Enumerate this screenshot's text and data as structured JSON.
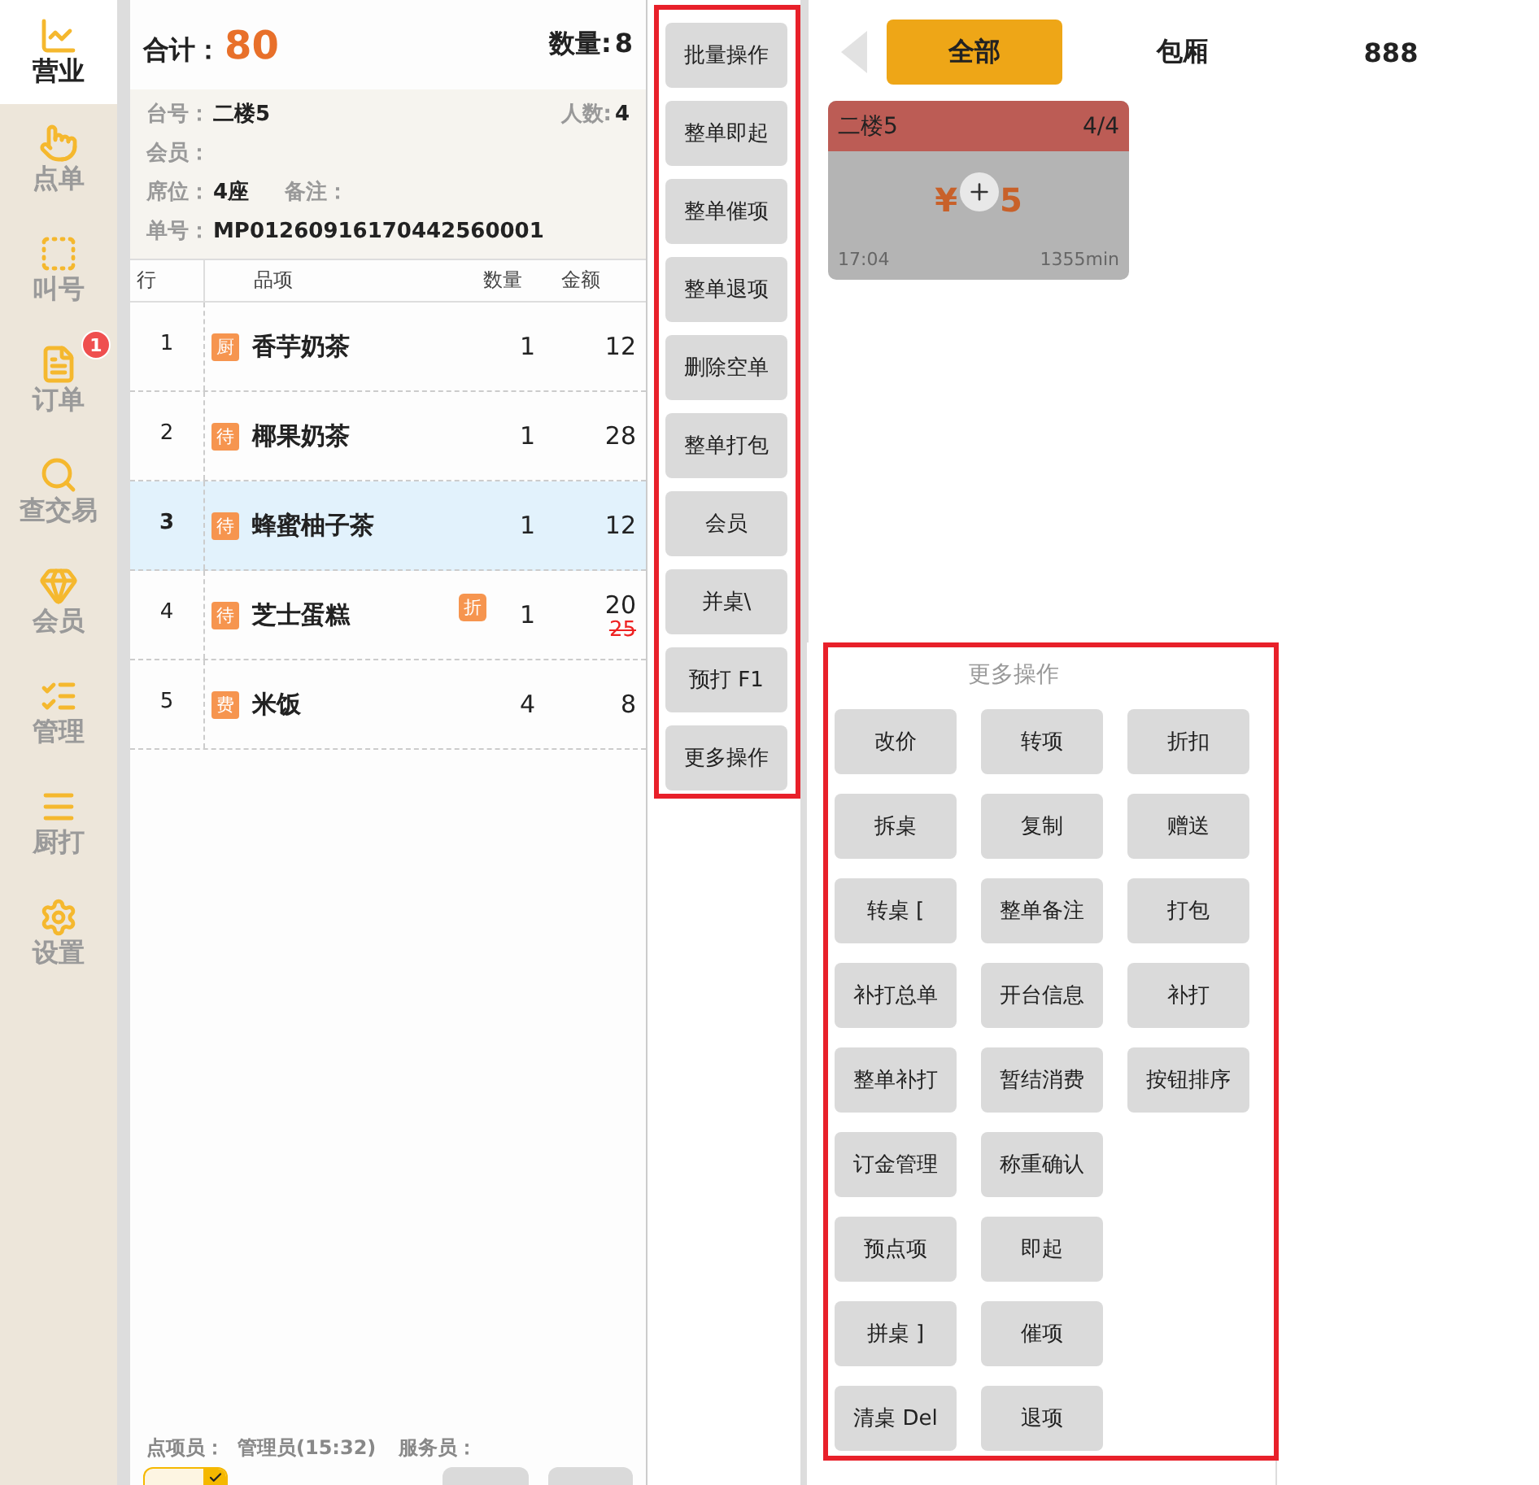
{
  "sidebar": {
    "items": [
      {
        "label": "营业",
        "kind": "business",
        "selected": true
      },
      {
        "label": "点单",
        "kind": "order",
        "selected": false
      },
      {
        "label": "叫号",
        "kind": "call",
        "selected": false
      },
      {
        "label": "订单",
        "kind": "list",
        "selected": false,
        "badge": "1"
      },
      {
        "label": "查交易",
        "kind": "search",
        "selected": false
      },
      {
        "label": "会员",
        "kind": "member",
        "selected": false
      },
      {
        "label": "管理",
        "kind": "manage",
        "selected": false
      },
      {
        "label": "厨打",
        "kind": "kitchen",
        "selected": false
      },
      {
        "label": "设置",
        "kind": "settings",
        "selected": false
      }
    ]
  },
  "order": {
    "total_label": "合计：",
    "total": "80",
    "count_label": "数量:",
    "count": "8",
    "info": {
      "table_label": "台号：",
      "table": "二楼5",
      "guests_label": "人数:",
      "guests": "4",
      "member_label": "会员：",
      "seat_label": "席位：",
      "seat": "4座",
      "remark_label": "备注：",
      "number_label": "单号：",
      "number": "MP01260916170442560001"
    },
    "columns": [
      "行",
      "品项",
      "数量",
      "金额"
    ],
    "rows": [
      {
        "no": "1",
        "tag": "厨",
        "name": "香芋奶茶",
        "qty": "1",
        "amount": "12",
        "selected": false
      },
      {
        "no": "2",
        "tag": "待",
        "name": "椰果奶茶",
        "qty": "1",
        "amount": "28",
        "selected": false
      },
      {
        "no": "3",
        "tag": "待",
        "name": "蜂蜜柚子茶",
        "qty": "1",
        "amount": "12",
        "selected": true
      },
      {
        "no": "4",
        "tag": "待",
        "name": "芝士蛋糕",
        "qty": "1",
        "amount": "20",
        "selected": false,
        "discount_tag": "折",
        "original_amount": "25"
      },
      {
        "no": "5",
        "tag": "费",
        "name": "米饭",
        "qty": "4",
        "amount": "8",
        "selected": false
      }
    ],
    "footer": {
      "clerk_label": "点项员：",
      "clerk": "管理员(15:32)",
      "waiter_label": "服务员："
    },
    "footer_buttons": [
      {
        "selected": true
      },
      {
        "selected": false
      },
      {
        "selected": false
      }
    ]
  },
  "actions": [
    "批量操作",
    "整单即起",
    "整单催项",
    "整单退项",
    "删除空单",
    "整单打包",
    "会员",
    "并桌\\",
    "预打 F1",
    "更多操作"
  ],
  "more_actions": {
    "title": "更多操作",
    "rows": [
      [
        "改价",
        "转项",
        "折扣"
      ],
      [
        "拆桌",
        "复制",
        "赠送"
      ],
      [
        "转桌 [",
        "整单备注",
        "打包"
      ],
      [
        "补打总单",
        "开台信息",
        "补打"
      ],
      [
        "整单补打",
        "暂结消费",
        "按钮排序"
      ],
      [
        "订金管理",
        "称重确认"
      ],
      [
        "预点项",
        "即起"
      ],
      [
        "拼桌 ]",
        "催项"
      ],
      [
        "清桌 Del",
        "退项"
      ]
    ]
  },
  "areas": {
    "tabs": [
      {
        "label": "全部",
        "selected": true
      },
      {
        "label": "包厢",
        "selected": false
      },
      {
        "label": "888",
        "selected": false
      }
    ]
  },
  "tables": [
    {
      "name": "二楼5",
      "seats": "4/4",
      "amount_parts": [
        "¥",
        "5"
      ],
      "time": "17:04",
      "duration": "1355min",
      "kind": "occupied"
    }
  ]
}
